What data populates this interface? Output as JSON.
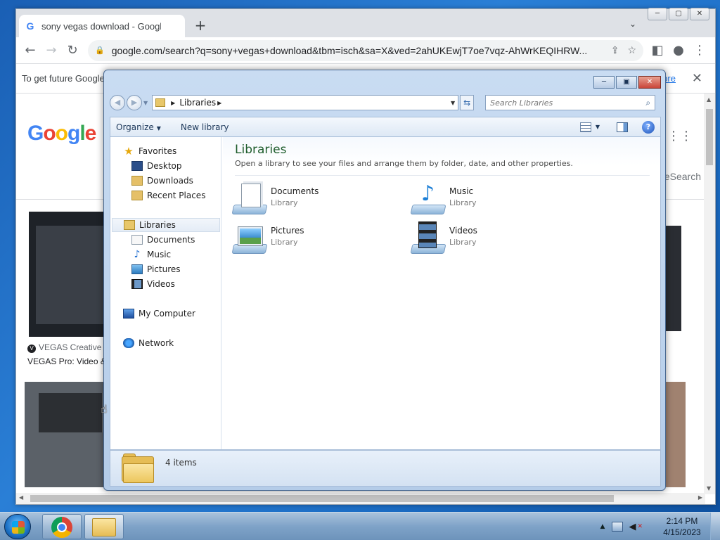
{
  "browser": {
    "tab_title": "sony vegas download - Google Search",
    "tab_close": "×",
    "new_tab": "+",
    "address": "google.com/search?q=sony+vegas+download&tbm=isch&sa=X&ved=2ahUKEwjT7oe7vqz-AhWrKEQIHRW...",
    "infobar_text": "To get future Google",
    "infobar_link": "ore",
    "google_logo": "Google",
    "safesearch": "eSearch",
    "image_source": "VEGAS Creative S",
    "image_caption": "VEGAS Pro: Video &"
  },
  "explorer": {
    "address_crumb": "Libraries",
    "search_placeholder": "Search Libraries",
    "toolbar": {
      "organize": "Organize",
      "new_library": "New library"
    },
    "nav": {
      "favorites": "Favorites",
      "desktop": "Desktop",
      "downloads": "Downloads",
      "recent_places": "Recent Places",
      "libraries": "Libraries",
      "documents": "Documents",
      "music": "Music",
      "pictures": "Pictures",
      "videos": "Videos",
      "my_computer": "My Computer",
      "network": "Network"
    },
    "content": {
      "title": "Libraries",
      "subtitle": "Open a library to see your files and arrange them by folder, date, and other properties.",
      "items": [
        {
          "name": "Documents",
          "type": "Library",
          "icon": "documents-library-icon"
        },
        {
          "name": "Music",
          "type": "Library",
          "icon": "music-library-icon"
        },
        {
          "name": "Pictures",
          "type": "Library",
          "icon": "pictures-library-icon"
        },
        {
          "name": "Videos",
          "type": "Library",
          "icon": "videos-library-icon"
        }
      ]
    },
    "status": "4 items"
  },
  "taskbar": {
    "time": "2:14 PM",
    "date": "4/15/2023"
  }
}
